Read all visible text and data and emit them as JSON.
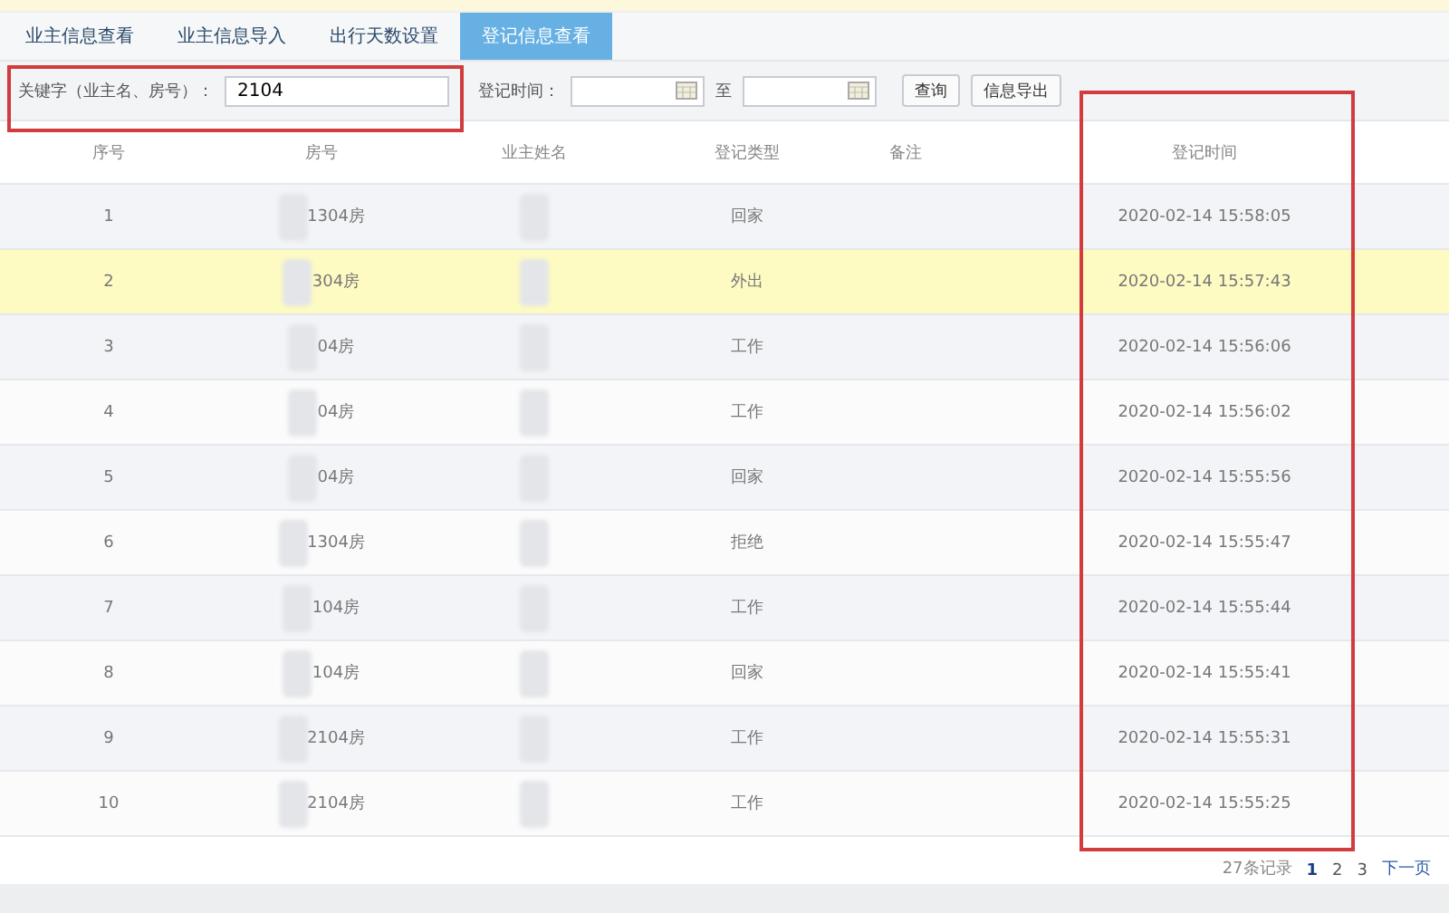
{
  "tabs": [
    {
      "label": "业主信息查看",
      "selected": false
    },
    {
      "label": "业主信息导入",
      "selected": false
    },
    {
      "label": "出行天数设置",
      "selected": false
    },
    {
      "label": "登记信息查看",
      "selected": true
    }
  ],
  "filters": {
    "keyword_label": "关键字（业主名、房号）：",
    "keyword_value": "2104",
    "time_label": "登记时间：",
    "range_separator": "至",
    "buttons": [
      "查询",
      "信息导出"
    ]
  },
  "table": {
    "columns": [
      "序号",
      "房号",
      "业主姓名",
      "登记类型",
      "备注",
      "登记时间"
    ],
    "rows": [
      {
        "index": "1",
        "room": "1304房",
        "type": "回家",
        "time": "2020-02-14 15:58:05",
        "selected": false
      },
      {
        "index": "2",
        "room": "304房",
        "type": "外出",
        "time": "2020-02-14 15:57:43",
        "selected": true
      },
      {
        "index": "3",
        "room": "04房",
        "type": "工作",
        "time": "2020-02-14 15:56:06",
        "selected": false
      },
      {
        "index": "4",
        "room": "04房",
        "type": "工作",
        "time": "2020-02-14 15:56:02",
        "selected": false
      },
      {
        "index": "5",
        "room": "04房",
        "type": "回家",
        "time": "2020-02-14 15:55:56",
        "selected": false
      },
      {
        "index": "6",
        "room": "1304房",
        "type": "拒绝",
        "time": "2020-02-14 15:55:47",
        "selected": false
      },
      {
        "index": "7",
        "room": "104房",
        "type": "工作",
        "time": "2020-02-14 15:55:44",
        "selected": false
      },
      {
        "index": "8",
        "room": "104房",
        "type": "回家",
        "time": "2020-02-14 15:55:41",
        "selected": false
      },
      {
        "index": "9",
        "room": "2104房",
        "type": "工作",
        "time": "2020-02-14 15:55:31",
        "selected": false
      },
      {
        "index": "10",
        "room": "2104房",
        "type": "工作",
        "time": "2020-02-14 15:55:25",
        "selected": false
      }
    ]
  },
  "pagination": {
    "total": "27条记录",
    "pages": [
      {
        "label": "1",
        "selected": true
      },
      {
        "label": "2",
        "selected": false
      },
      {
        "label": "3",
        "selected": false
      }
    ],
    "next": "下一页"
  }
}
